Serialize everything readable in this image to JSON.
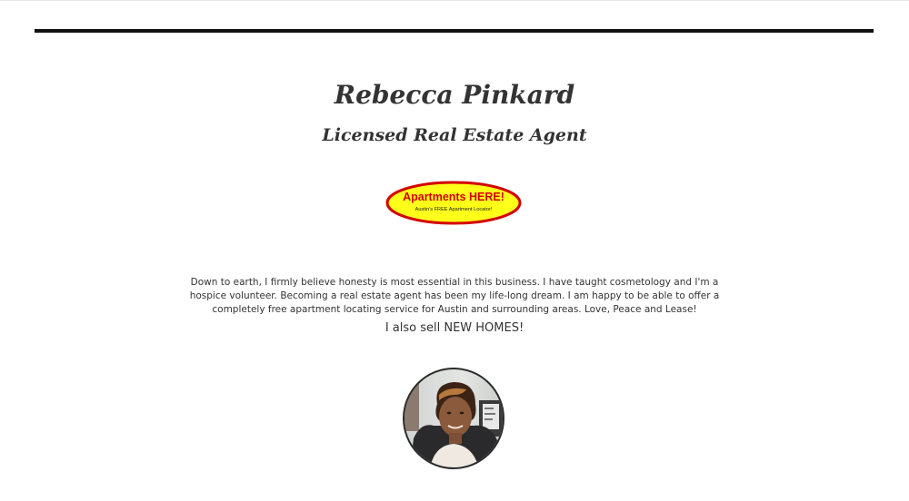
{
  "profile": {
    "name": "Rebecca Pinkard",
    "title": "Licensed Real Estate Agent",
    "bio": "Down to earth, I firmly believe honesty is most essential in this business. I have taught cosmetology and I'm a hospice volunteer. Becoming a real estate agent has been my life-long dream. I am happy to be able to offer a completely free apartment locating service for Austin and surrounding areas. Love, Peace and Lease!",
    "sell_line": "I also sell NEW HOMES!"
  },
  "logo": {
    "headline": "Apartments HERE!",
    "tagline": "Austin's FREE Apartment Locator!",
    "colors": {
      "fill": "#ffff1a",
      "border": "#d40000",
      "headline_text": "#d40000",
      "tagline_text": "#1a1a1a"
    }
  },
  "colors": {
    "header_rule": "#111111",
    "text": "#333333",
    "background": "#ffffff"
  },
  "avatar": {
    "icon": "profile-photo"
  }
}
